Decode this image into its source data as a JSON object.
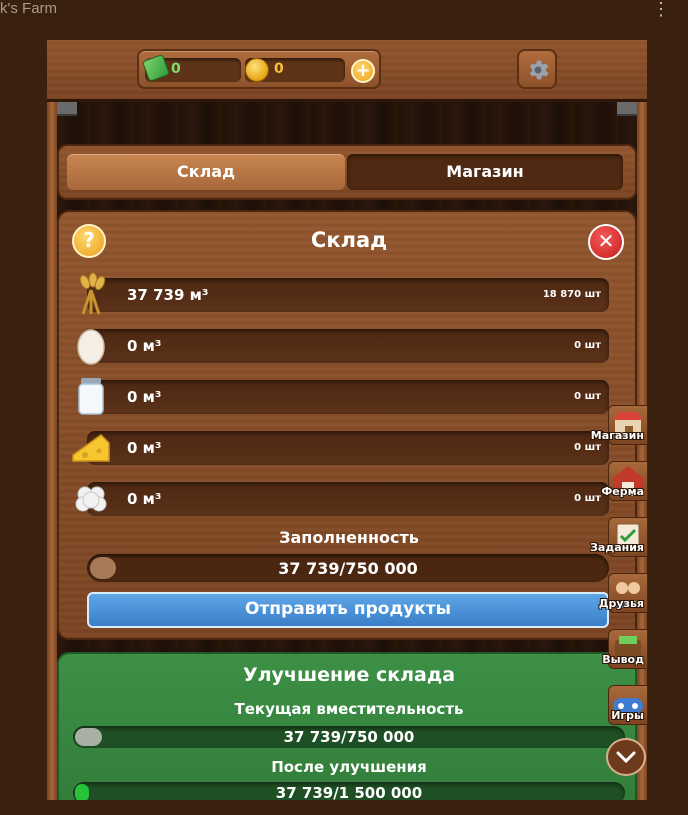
{
  "window": {
    "title": "k's Farm",
    "menu_icon": "kebab-menu-icon"
  },
  "topbar": {
    "cash_value": "0",
    "coin_value": "0",
    "plus_label": "+",
    "settings_icon": "gear-icon"
  },
  "tabs": [
    {
      "label": "Склад",
      "active": true
    },
    {
      "label": "Магазин",
      "active": false
    }
  ],
  "warehouse": {
    "title": "Склад",
    "help_label": "?",
    "close_label": "✕",
    "items": [
      {
        "icon": "wheat-icon",
        "amount": "37 739 м³",
        "count": "18 870 шт"
      },
      {
        "icon": "egg-icon",
        "amount": "0 м³",
        "count": "0 шт"
      },
      {
        "icon": "milk-jar-icon",
        "amount": "0 м³",
        "count": "0 шт"
      },
      {
        "icon": "cheese-icon",
        "amount": "0 м³",
        "count": "0 шт"
      },
      {
        "icon": "cotton-icon",
        "amount": "0 м³",
        "count": "0 шт"
      }
    ],
    "fill_label": "Заполненность",
    "fill_text": "37 739/750 000",
    "fill_fraction": 0.05,
    "send_button": "Отправить продукты"
  },
  "upgrade": {
    "title": "Улучшение склада",
    "current_label": "Текущая вместительность",
    "current_text": "37 739/750 000",
    "current_fraction": 0.05,
    "after_label": "После улучшения",
    "after_text": "37 739/1 500 000",
    "after_fraction": 0.025
  },
  "side_nav": [
    {
      "label": "Магазин",
      "icon": "shop-icon"
    },
    {
      "label": "Ферма",
      "icon": "barn-icon"
    },
    {
      "label": "Задания",
      "icon": "task-list-icon"
    },
    {
      "label": "Друзья",
      "icon": "friends-icon"
    },
    {
      "label": "Вывод",
      "icon": "wallet-icon"
    },
    {
      "label": "Игры",
      "icon": "gamepad-icon"
    }
  ],
  "scroll_icon": "chevron-down-icon",
  "colors": {
    "accent_blue": "#3a7fc8",
    "upgrade_green": "#3d9045",
    "wood": "#93562e"
  }
}
